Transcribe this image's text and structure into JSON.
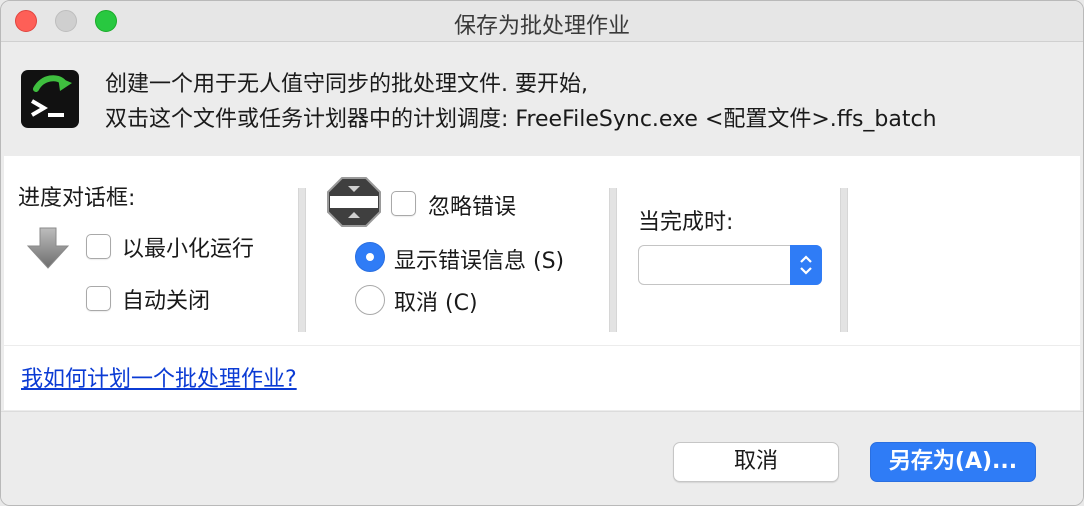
{
  "window": {
    "title": "保存为批处理作业"
  },
  "header": {
    "line1": "创建一个用于无人值守同步的批处理文件. 要开始,",
    "line2": "双击这个文件或任务计划器中的计划调度: FreeFileSync.exe <配置文件>.ffs_batch",
    "icon": "terminal-icon"
  },
  "progress_dialog": {
    "label": "进度对话框:",
    "icon": "arrow-down-icon",
    "minimize_label": "以最小化运行",
    "minimize_checked": false,
    "auto_close_label": "自动关闭",
    "auto_close_checked": false
  },
  "errors": {
    "icon": "error-stop-icon",
    "ignore_label": "忽略错误",
    "ignore_checked": false,
    "show_label": "显示错误信息 (S)",
    "show_selected": true,
    "cancel_label": "取消 (C)",
    "cancel_selected": false
  },
  "on_completion": {
    "label": "当完成时:",
    "selected_value": ""
  },
  "help_link": "我如何计划一个批处理作业?",
  "buttons": {
    "cancel": "取消",
    "save_as": "另存为(A)..."
  },
  "colors": {
    "accent": "#2f7cf6",
    "link": "#0b3bd4"
  }
}
